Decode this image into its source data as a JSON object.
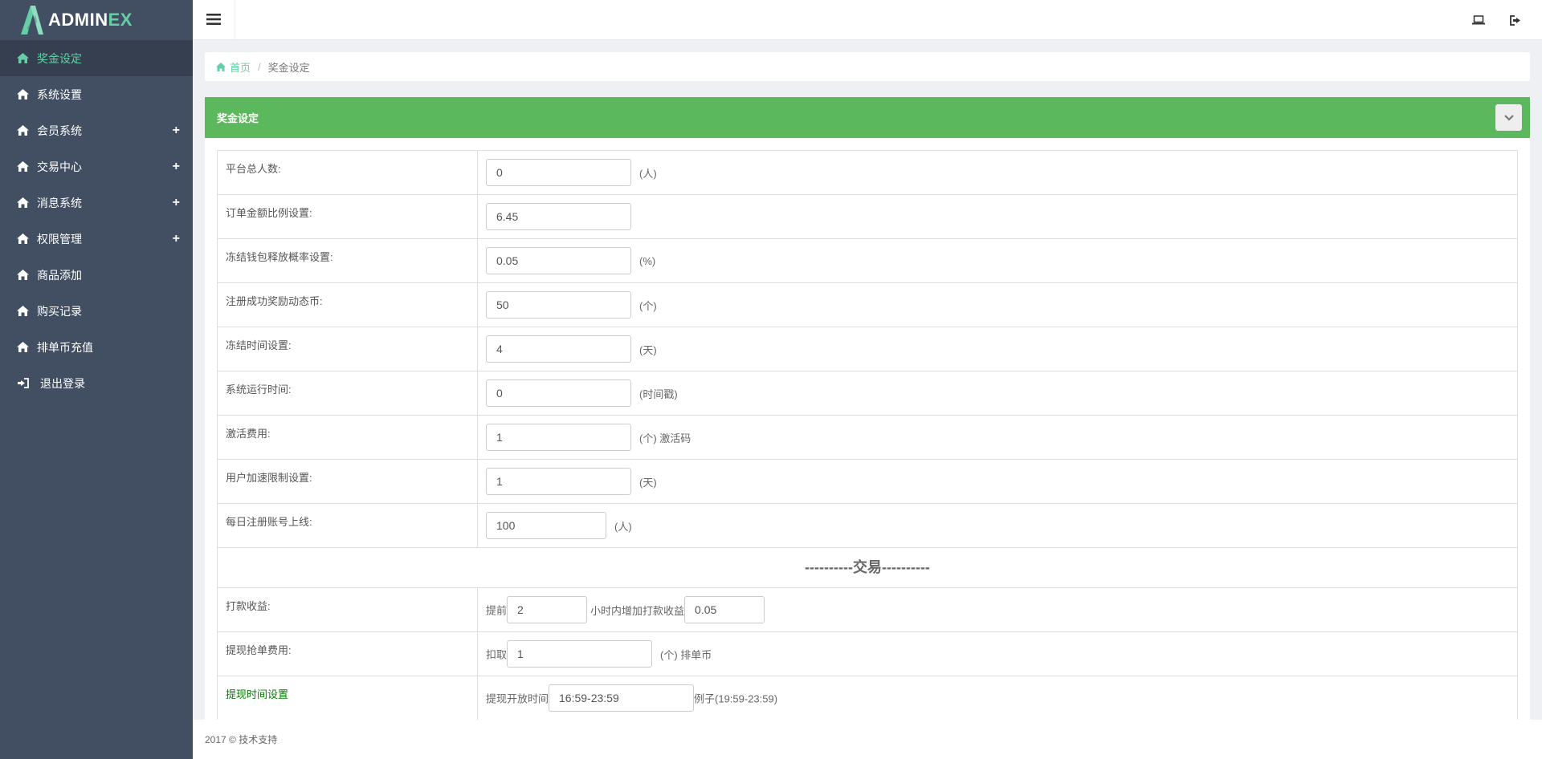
{
  "logo": {
    "main": "ADMIN",
    "accent": "EX"
  },
  "sidebar": {
    "items": [
      {
        "label": "奖金设定",
        "icon": "home-icon",
        "active": true,
        "expandable": false
      },
      {
        "label": "系统设置",
        "icon": "home-icon",
        "active": false,
        "expandable": false
      },
      {
        "label": "会员系统",
        "icon": "home-icon",
        "active": false,
        "expandable": true
      },
      {
        "label": "交易中心",
        "icon": "home-icon",
        "active": false,
        "expandable": true
      },
      {
        "label": "消息系统",
        "icon": "home-icon",
        "active": false,
        "expandable": true
      },
      {
        "label": "权限管理",
        "icon": "home-icon",
        "active": false,
        "expandable": true
      },
      {
        "label": "商品添加",
        "icon": "home-icon",
        "active": false,
        "expandable": false
      },
      {
        "label": "购买记录",
        "icon": "home-icon",
        "active": false,
        "expandable": false
      },
      {
        "label": "排单币充值",
        "icon": "home-icon",
        "active": false,
        "expandable": false
      },
      {
        "label": "退出登录",
        "icon": "sign-in-icon",
        "active": false,
        "expandable": false
      }
    ],
    "plus_symbol": "+"
  },
  "header": {
    "menu_icon": "hamburger-icon",
    "right_icons": [
      "laptop-icon",
      "sign-out-icon"
    ]
  },
  "breadcrumb": {
    "home": "首页",
    "separator": "/",
    "current": "奖金设定"
  },
  "panel": {
    "title": "奖金设定",
    "collapse_icon": "chevron-down-icon"
  },
  "form": {
    "platform_total": {
      "label": "平台总人数:",
      "value": "0",
      "unit": "(人)"
    },
    "order_ratio": {
      "label": "订单金额比例设置:",
      "value": "6.45"
    },
    "freeze_release": {
      "label": "冻结钱包释放概率设置:",
      "value": "0.05",
      "unit": "(%)"
    },
    "register_reward": {
      "label": "注册成功奖励动态币:",
      "value": "50",
      "unit": "(个)"
    },
    "freeze_time": {
      "label": "冻结时间设置:",
      "value": "4",
      "unit": "(天)"
    },
    "run_time": {
      "label": "系统运行时间:",
      "value": "0",
      "unit": "(时间戳)"
    },
    "activation_fee": {
      "label": "激活费用:",
      "value": "1",
      "unit": "(个) 激活码"
    },
    "speedup_limit": {
      "label": "用户加速限制设置:",
      "value": "1",
      "unit": "(天)"
    },
    "daily_register": {
      "label": "每日注册账号上线:",
      "value": "100",
      "unit": "(人)"
    },
    "section_trade": "----------交易----------",
    "payment_income": {
      "label": "打款收益:",
      "prefix": "提前",
      "hours": "2",
      "middle": "小时内增加打款收益",
      "rate": "0.05"
    },
    "withdraw_fee": {
      "label": "提现抢单费用:",
      "prefix": "扣取",
      "value": "1",
      "unit": "(个) 排单币"
    },
    "withdraw_time": {
      "label": "提现时间设置",
      "prefix": "提现开放时间",
      "value": "16:59-23:59",
      "example": "例子(19:59-23:59)"
    }
  },
  "footer": {
    "text": "2017 © 技术支持"
  },
  "colors": {
    "sidebar": "#424f63",
    "accent": "#65cea7",
    "panel_header": "#5cb85c"
  }
}
